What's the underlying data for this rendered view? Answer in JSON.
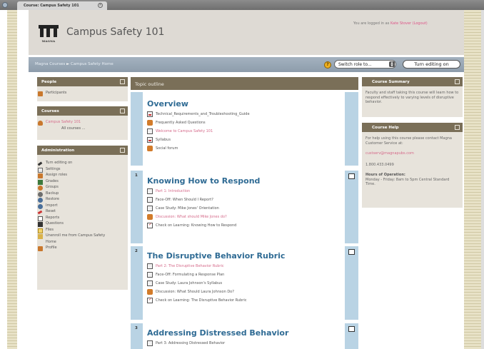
{
  "browser": {
    "tab_title": "Course: Campus Safety 101"
  },
  "header": {
    "site_title": "Campus Safety 101",
    "logo_text": "MAGNA",
    "login_prefix": "You are logged in as",
    "user_name": "Kate Stover",
    "logout": "(Logout)"
  },
  "nav": {
    "breadcrumb_home": "Magna Courses",
    "breadcrumb_sep": "►",
    "breadcrumb_course": "Campus Safety Home",
    "role_select": "Switch role to...",
    "edit_button": "Turn editing on"
  },
  "left": {
    "people": {
      "title": "People",
      "items": [
        "Participants"
      ]
    },
    "courses": {
      "title": "Courses",
      "course": "Campus Safety 101",
      "all": "All courses ..."
    },
    "admin": {
      "title": "Administration",
      "items": [
        "Turn editing on",
        "Settings",
        "Assign roles",
        "Grades",
        "Groups",
        "Backup",
        "Restore",
        "Import",
        "Reset",
        "Reports",
        "Questions",
        "Files",
        "Unenroll me from Campus Safety",
        "Home",
        "Profile"
      ]
    }
  },
  "topic_outline": "Topic outline",
  "sections": [
    {
      "number": "",
      "title": "Overview",
      "items": [
        {
          "label": "Technical_Requirements_and_Troubleshooting_Guide",
          "icon": "pdf-icon",
          "pink": false
        },
        {
          "label": "Frequently Asked Questions",
          "icon": "forum-icon",
          "pink": false
        },
        {
          "label": "Welcome to Campus Safety 101",
          "icon": "doc-icon",
          "pink": true
        },
        {
          "label": "Syllabus",
          "icon": "pdf-icon",
          "pink": false
        },
        {
          "label": "Social forum",
          "icon": "forum-icon",
          "pink": false
        }
      ]
    },
    {
      "number": "1",
      "title": "Knowing How to Respond",
      "items": [
        {
          "label": "Part 1: Introduction",
          "icon": "doc-icon",
          "pink": true
        },
        {
          "label": "Face-Off: When Should I Report?",
          "icon": "doc-icon",
          "pink": false
        },
        {
          "label": "Case Study: Mike Jones' Orientation",
          "icon": "doc-icon",
          "pink": false
        },
        {
          "label": "Discussion: What should Mike Jones do?",
          "icon": "forum-icon",
          "pink": true
        },
        {
          "label": "Check on Learning: Knowing How to Respond",
          "icon": "quiz-icon",
          "pink": false
        }
      ]
    },
    {
      "number": "2",
      "title": "The Disruptive Behavior Rubric",
      "items": [
        {
          "label": "Part 2: The Disruptive Behavior Rubric",
          "icon": "doc-icon",
          "pink": true
        },
        {
          "label": "Face-Off: Formulating a Response Plan",
          "icon": "doc-icon",
          "pink": false
        },
        {
          "label": "Case Study: Laura Johnson's Syllabus",
          "icon": "doc-icon",
          "pink": false
        },
        {
          "label": "Discussion: What Should Laura Johnson Do?",
          "icon": "forum-icon",
          "pink": false
        },
        {
          "label": "Check on Learning: The Disruptive Behavior Rubric",
          "icon": "quiz-icon",
          "pink": false
        }
      ]
    },
    {
      "number": "3",
      "title": "Addressing Distressed Behavior",
      "items": [
        {
          "label": "Part 3: Addressing Distressed Behavior",
          "icon": "doc-icon",
          "pink": false
        }
      ]
    }
  ],
  "right": {
    "summary": {
      "title": "Course Summary",
      "text": "Faculty and staff taking this course will learn how to respond effectively to varying levels of disruptive behavior."
    },
    "help": {
      "title": "Course Help",
      "intro": "For help using this course please contact Magna Customer Service at:",
      "email": "custserv@magnapubs.com",
      "phone": "1.800.433.0499",
      "hours_title": "Hours of Operation:",
      "hours_text": "Monday - Friday: 8am to 5pm Central Standard Time."
    }
  }
}
